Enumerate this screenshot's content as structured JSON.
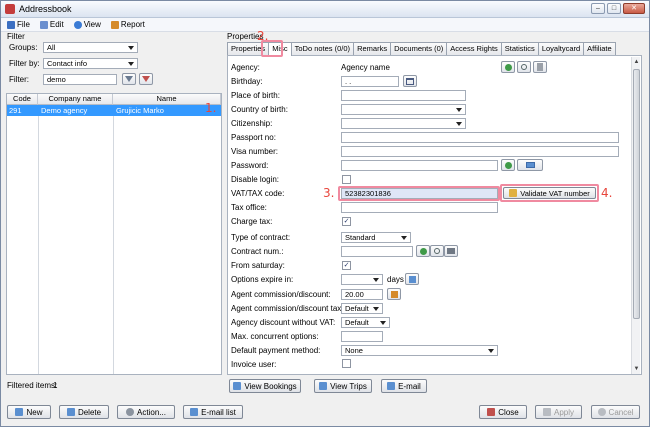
{
  "window": {
    "title": "Addressbook"
  },
  "menu": [
    {
      "label": "File",
      "color": "#3b6fc2"
    },
    {
      "label": "Edit",
      "color": "#6b8fcf"
    },
    {
      "label": "View",
      "color": "#3a7bd5"
    },
    {
      "label": "Report",
      "color": "#d58a2a"
    }
  ],
  "filter": {
    "section_title": "Filter",
    "groups_label": "Groups:",
    "groups_value": "All",
    "filterby_label": "Filter by:",
    "filterby_value": "Contact info",
    "filter_label": "Filter:",
    "filter_value": "demo",
    "columns": [
      "Code",
      "Company name",
      "Name"
    ],
    "rows": [
      {
        "code": "291",
        "company": "Demo agency",
        "name": "Grujicic Marko"
      }
    ],
    "filtered_label": "Filtered items:",
    "filtered_count": "1"
  },
  "properties": {
    "section_title": "Properties",
    "tabs": [
      "Properties",
      "Misc",
      "ToDo notes (0/0)",
      "Remarks",
      "Documents (0)",
      "Access Rights",
      "Statistics",
      "Loyaltycard",
      "Affiliate"
    ],
    "active_tab": "Misc",
    "rows": {
      "agency": {
        "label": "Agency:",
        "value": "Agency name"
      },
      "birthday": {
        "label": "Birthday:",
        "value": " .  ."
      },
      "place_of_birth": {
        "label": "Place of birth:"
      },
      "country_of_birth": {
        "label": "Country of birth:"
      },
      "citizenship": {
        "label": "Citizenship:"
      },
      "passport_no": {
        "label": "Passport no:"
      },
      "visa_number": {
        "label": "Visa number:"
      },
      "password": {
        "label": "Password:"
      },
      "disable_login": {
        "label": "Disable login:",
        "checked": false
      },
      "vat_tax_code": {
        "label": "VAT/TAX code:",
        "value": "52382301836"
      },
      "tax_office": {
        "label": "Tax office:"
      },
      "charge_tax": {
        "label": "Charge tax:",
        "checked": true
      },
      "type_of_contract": {
        "label": "Type of contract:",
        "value": "Standard"
      },
      "contract_num": {
        "label": "Contract num.:"
      },
      "from_saturday": {
        "label": "From saturday:",
        "checked": true
      },
      "options_expire": {
        "label": "Options expire in:",
        "unit": "days"
      },
      "agent_commission": {
        "label": "Agent commission/discount:",
        "value": "20.00"
      },
      "agent_commission_tax": {
        "label": "Agent commission/discount tax:",
        "value": "Default"
      },
      "agency_discount": {
        "label": "Agency discount without VAT:",
        "value": "Default"
      },
      "max_concurrent": {
        "label": "Max. concurrent options:"
      },
      "default_payment": {
        "label": "Default payment method:",
        "value": "None"
      },
      "invoice_user": {
        "label": "Invoice user:",
        "checked": false
      }
    },
    "validate_vat_button": "Validate VAT number",
    "view_bookings": "View Bookings",
    "view_trips": "View Trips",
    "email": "E-mail"
  },
  "annotations": [
    "1.",
    "2.",
    "3.",
    "4."
  ],
  "footer": {
    "new": "New",
    "delete": "Delete",
    "action": "Action...",
    "email_list": "E-mail list",
    "close": "Close",
    "apply": "Apply",
    "cancel": "Cancel"
  },
  "colors": {
    "selection": "#3399ff",
    "annotation": "#e8463c",
    "highlight": "#f08aa0"
  }
}
